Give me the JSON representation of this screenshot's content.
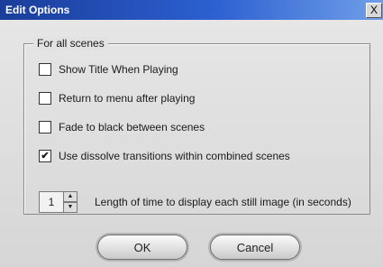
{
  "window": {
    "title": "Edit Options",
    "close_glyph": "X"
  },
  "group": {
    "legend": "For all scenes",
    "options": [
      {
        "label": "Show Title When Playing",
        "checked": false
      },
      {
        "label": "Return to menu after playing",
        "checked": false
      },
      {
        "label": "Fade to black between scenes",
        "checked": false
      },
      {
        "label": "Use dissolve transitions within combined scenes",
        "checked": true
      }
    ],
    "still_duration": {
      "value": "1",
      "label": "Length of time to display each still image (in seconds)",
      "up_icon": "arrow-up-icon",
      "down_icon": "arrow-down-icon"
    }
  },
  "buttons": {
    "ok": "OK",
    "cancel": "Cancel"
  }
}
